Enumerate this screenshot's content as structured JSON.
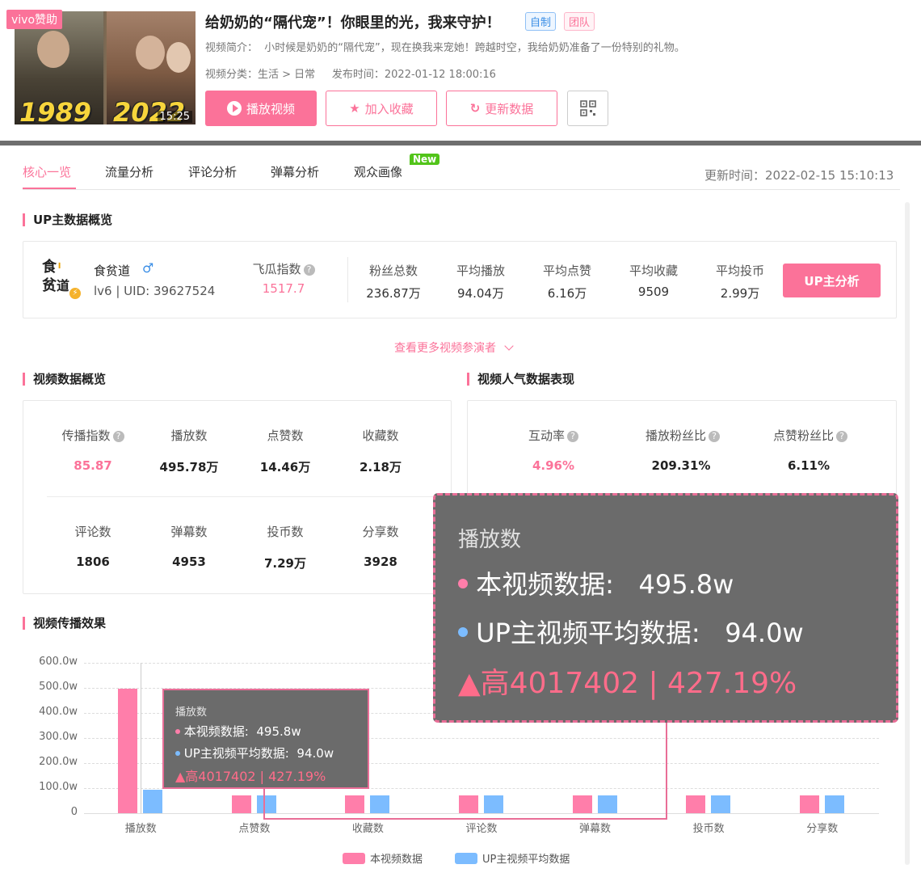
{
  "header": {
    "sponsor_badge": "vivo赞助",
    "year_left": "1989",
    "year_right": "2022",
    "duration": "15:25",
    "title": "给奶奶的“隔代宠”！你眼里的光，我来守护！",
    "tag_self": "自制",
    "tag_team": "团队",
    "description_label": "视频简介：",
    "description": "小时候是奶奶的“隔代宠”，现在换我来宠她！跨越时空，我给奶奶准备了一份特别的礼物。",
    "category_label": "视频分类：",
    "category": "生活 > 日常",
    "publish_label": "发布时间：",
    "publish_time": "2022-01-12 18:00:16",
    "buttons": {
      "play": "播放视频",
      "favorite": "加入收藏",
      "refresh": "更新数据"
    }
  },
  "tabs": [
    "核心一览",
    "流量分析",
    "评论分析",
    "弹幕分析",
    "观众画像"
  ],
  "new_badge": "New",
  "updated": "更新时间：2022-02-15 15:10:13",
  "up_section": {
    "title": "UP主数据概览",
    "name": "食贫道",
    "gender_icon": "♂",
    "level_uid": "lv6 | UID: 39627524",
    "index_label": "飞瓜指数",
    "index_value": "1517.7",
    "stats": [
      {
        "label": "粉丝总数",
        "value": "236.87万"
      },
      {
        "label": "平均播放",
        "value": "94.04万"
      },
      {
        "label": "平均点赞",
        "value": "6.16万"
      },
      {
        "label": "平均收藏",
        "value": "9509"
      },
      {
        "label": "平均投币",
        "value": "2.99万"
      }
    ],
    "analyze_button": "UP主分析",
    "more_link": "查看更多视频参演者"
  },
  "video_section": {
    "title": "视频数据概览",
    "row1": [
      {
        "label": "传播指数",
        "value": "85.87"
      },
      {
        "label": "播放数",
        "value": "495.78万"
      },
      {
        "label": "点赞数",
        "value": "14.46万"
      },
      {
        "label": "收藏数",
        "value": "2.18万"
      }
    ],
    "row2": [
      {
        "label": "评论数",
        "value": "1806"
      },
      {
        "label": "弹幕数",
        "value": "4953"
      },
      {
        "label": "投币数",
        "value": "7.29万"
      },
      {
        "label": "分享数",
        "value": "3928"
      }
    ]
  },
  "popularity_section": {
    "title": "视频人气数据表现",
    "items": [
      {
        "label": "互动率",
        "value": "4.96%"
      },
      {
        "label": "播放粉丝比",
        "value": "209.31%"
      },
      {
        "label": "点赞粉丝比",
        "value": "6.11%"
      }
    ]
  },
  "spread_section": {
    "title": "视频传播效果"
  },
  "tooltip": {
    "title": "播放数",
    "this_label": "本视频数据:",
    "this_value": "495.8w",
    "avg_label": "UP主视频平均数据:",
    "avg_value": "94.0w",
    "diff": "▲高4017402 | 427.19%"
  },
  "colors": {
    "accent": "#fb7299",
    "series_this": "#ff7eaa",
    "series_avg": "#7cbcff"
  },
  "chart_data": {
    "type": "bar",
    "categories": [
      "播放数",
      "点赞数",
      "收藏数",
      "评论数",
      "弹幕数",
      "投币数",
      "分享数"
    ],
    "series": [
      {
        "name": "本视频数据",
        "values": [
          495.8,
          14.5,
          2.2,
          0.2,
          0.5,
          7.3,
          0.4
        ]
      },
      {
        "name": "UP主视频平均数据",
        "values": [
          94.0,
          6.2,
          1.0,
          0.3,
          0.5,
          3.0,
          0.3
        ]
      }
    ],
    "yticks": [
      "600.0w",
      "500.0w",
      "400.0w",
      "300.0w",
      "200.0w",
      "100.0w",
      "0"
    ],
    "ylim": [
      0,
      600
    ],
    "legend_position": "bottom"
  }
}
